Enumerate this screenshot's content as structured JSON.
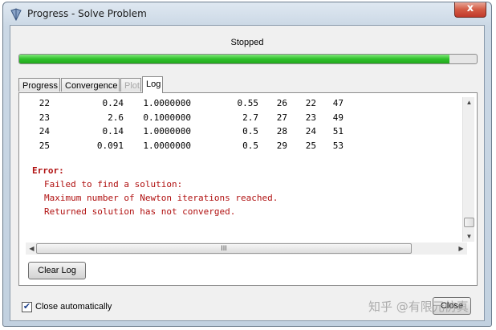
{
  "window": {
    "title": "Progress - Solve Problem",
    "icon": "app-icon",
    "close_glyph": "x"
  },
  "status": {
    "text": "Stopped",
    "progress": 0.94
  },
  "tabs": [
    {
      "label": "Progress",
      "state": "normal"
    },
    {
      "label": "Convergence",
      "state": "normal"
    },
    {
      "label": "Plot",
      "state": "disabled"
    },
    {
      "label": "Log",
      "state": "active"
    }
  ],
  "log": {
    "rows": [
      [
        "22",
        "0.24",
        "1.0000000",
        "0.55",
        "26",
        "22",
        "47"
      ],
      [
        "23",
        "2.6",
        "0.1000000",
        "2.7",
        "27",
        "23",
        "49"
      ],
      [
        "24",
        "0.14",
        "1.0000000",
        "0.5",
        "28",
        "24",
        "51"
      ],
      [
        "25",
        "0.091",
        "1.0000000",
        "0.5",
        "29",
        "25",
        "53"
      ]
    ],
    "error_title": "Error:",
    "error_lines": [
      "Failed to find a solution:",
      "Maximum number of Newton iterations reached.",
      "Returned solution has not converged."
    ],
    "hscroll_grip": "III"
  },
  "buttons": {
    "clear_log": "Clear Log",
    "close": "Close"
  },
  "options": {
    "close_automatically_label": "Close automatically",
    "close_automatically_checked": true,
    "check_glyph": "✔"
  },
  "watermark": "知乎 @有限元仿真",
  "colors": {
    "progress_fill": "#2fc12a",
    "error_text": "#b01010",
    "close_button": "#c0392b"
  }
}
